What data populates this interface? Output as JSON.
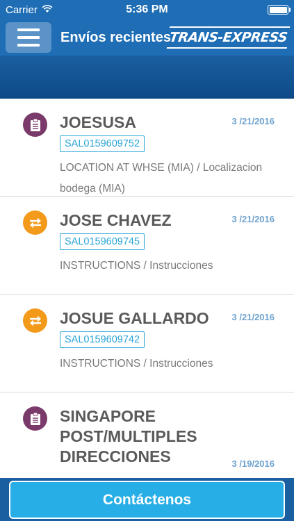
{
  "status_bar": {
    "carrier": "Carrier",
    "time": "5:36 PM"
  },
  "nav": {
    "title": "Envíos recientes",
    "logo_text": "TRANS-EXPRESS"
  },
  "shipments": [
    {
      "name": "JOESUSA",
      "date": "3 /21/2016",
      "tracking": "SAL0159609752",
      "status": "LOCATION AT WHSE (MIA) / Localizacion bodega (MIA)",
      "icon": "clipboard-icon",
      "color": "#7a3b6a"
    },
    {
      "name": "JOSE CHAVEZ",
      "date": "3 /21/2016",
      "tracking": "SAL0159609745",
      "status": "INSTRUCTIONS / Instrucciones",
      "icon": "transfer-arrows-icon",
      "color": "#f39a1b"
    },
    {
      "name": "JOSUE GALLARDO",
      "date": "3 /21/2016",
      "tracking": "SAL0159609742",
      "status": "INSTRUCTIONS / Instrucciones",
      "icon": "transfer-arrows-icon",
      "color": "#f39a1b"
    },
    {
      "name": "SINGAPORE POST/MULTIPLES DIRECCIONES",
      "date": "3 /19/2016",
      "tracking": "",
      "status": "",
      "icon": "clipboard-icon",
      "color": "#7a3b6a"
    }
  ],
  "footer": {
    "contact_label": "Contáctenos"
  },
  "colors": {
    "nav_blue": "#1f6eb5",
    "accent_cyan": "#28aee6",
    "date_blue": "#6fa3cf"
  }
}
